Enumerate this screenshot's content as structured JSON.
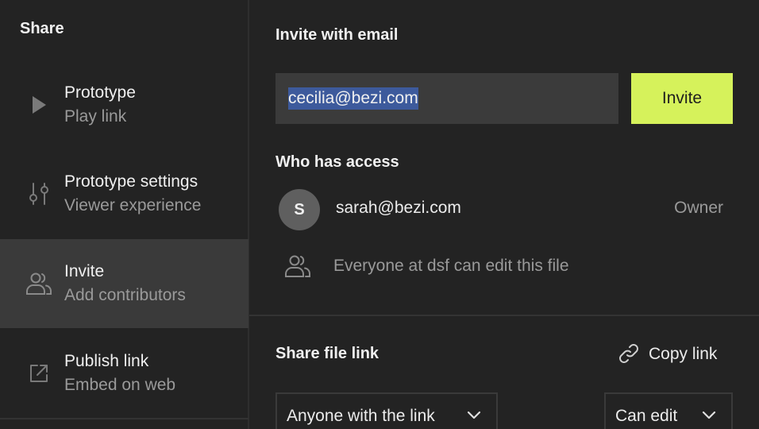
{
  "sidebar": {
    "title": "Share",
    "items": [
      {
        "label": "Prototype",
        "sub": "Play link",
        "icon": "play-icon",
        "active": false
      },
      {
        "label": "Prototype settings",
        "sub": "Viewer experience",
        "icon": "sliders-icon",
        "active": false
      },
      {
        "label": "Invite",
        "sub": "Add contributors",
        "icon": "users-icon",
        "active": true
      },
      {
        "label": "Publish link",
        "sub": "Embed on web",
        "icon": "external-link-icon",
        "active": false
      }
    ]
  },
  "invite": {
    "title": "Invite with email",
    "email_value": "cecilia@bezi.com",
    "button_label": "Invite"
  },
  "access": {
    "title": "Who has access",
    "owner": {
      "initial": "S",
      "email": "sarah@bezi.com",
      "role": "Owner"
    },
    "everyone_text": "Everyone at dsf can edit this file"
  },
  "share_link": {
    "title": "Share file link",
    "copy_label": "Copy link",
    "scope_value": "Anyone with the link",
    "permission_value": "Can edit"
  },
  "colors": {
    "accent": "#d6f25b",
    "background": "#232323",
    "active_item": "#3a3a3a",
    "input_bg": "#3b3b3b",
    "selection": "#3d5a9c"
  }
}
